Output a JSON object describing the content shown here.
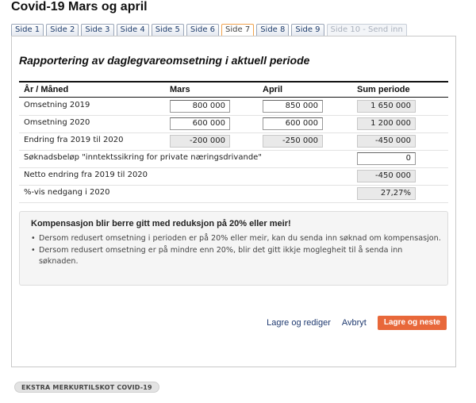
{
  "page": {
    "title": "Covid-19 Mars og april"
  },
  "tabs": [
    {
      "label": "Side 1",
      "state": "normal"
    },
    {
      "label": "Side 2",
      "state": "normal"
    },
    {
      "label": "Side 3",
      "state": "normal"
    },
    {
      "label": "Side 4",
      "state": "normal"
    },
    {
      "label": "Side 5",
      "state": "normal"
    },
    {
      "label": "Side 6",
      "state": "normal"
    },
    {
      "label": "Side 7",
      "state": "active"
    },
    {
      "label": "Side 8",
      "state": "normal"
    },
    {
      "label": "Side 9",
      "state": "normal"
    },
    {
      "label": "Side 10 - Send inn",
      "state": "disabled"
    }
  ],
  "form": {
    "heading": "Rapportering av daglegvareomsetning i aktuell periode",
    "columns": {
      "label": "År / Måned",
      "mars": "Mars",
      "april": "April",
      "sum": "Sum periode"
    },
    "rows": {
      "omsetning_2019": {
        "label": "Omsetning 2019",
        "mars": "800 000",
        "april": "850 000",
        "sum": "1 650 000"
      },
      "omsetning_2020": {
        "label": "Omsetning 2020",
        "mars": "600 000",
        "april": "600 000",
        "sum": "1 200 000"
      },
      "endring": {
        "label": "Endring fra 2019 til 2020",
        "mars": "-200 000",
        "april": "-250 000",
        "sum": "-450 000"
      },
      "soknadsbelop": {
        "label": "Søknadsbeløp \"inntektssikring for private næringsdrivande\"",
        "sum": "0"
      },
      "netto_endring": {
        "label": "Netto endring fra 2019 til 2020",
        "sum": "-450 000"
      },
      "prosent_nedgang": {
        "label": "%-vis nedgang i 2020",
        "sum": "27,27%"
      }
    }
  },
  "info": {
    "title": "Kompensasjon blir berre gitt med reduksjon på 20% eller meir!",
    "items": [
      "Dersom redusert omsetning i perioden er på 20% eller meir, kan du senda inn søknad om kompensasjon.",
      "Dersom redusert omsetning er på mindre enn 20%, blir det gitt ikkje moglegheit til å senda inn søknaden."
    ]
  },
  "actions": {
    "save_edit": "Lagre og rediger",
    "cancel": "Avbryt",
    "save_next": "Lagre og neste"
  },
  "footer": {
    "badge": "EKSTRA MERKURTILSKOT COVID-19"
  },
  "colors": {
    "primary_button": "#e8683a",
    "active_tab_border": "#f0a24c",
    "link": "#1f3a70"
  }
}
